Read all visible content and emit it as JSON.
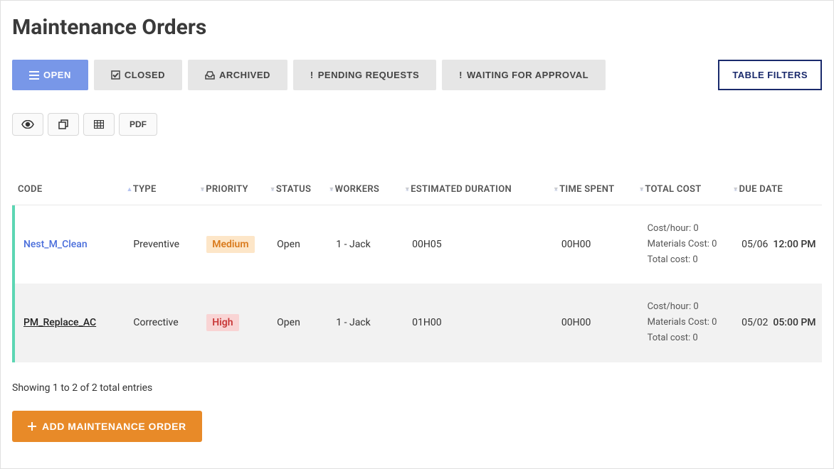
{
  "title": "Maintenance Orders",
  "tabs": {
    "open": "OPEN",
    "closed": "CLOSED",
    "archived": "ARCHIVED",
    "pending": "PENDING REQUESTS",
    "waiting": "WAITING FOR APPROVAL",
    "filters": "TABLE FILTERS"
  },
  "toolbar": {
    "pdf_label": "PDF"
  },
  "columns": {
    "code": "CODE",
    "type": "TYPE",
    "priority": "PRIORITY",
    "status": "STATUS",
    "workers": "WORKERS",
    "estdur": "ESTIMATED DURATION",
    "timespent": "TIME SPENT",
    "totalcost": "TOTAL COST",
    "duedate": "DUE DATE"
  },
  "rows": [
    {
      "code": "Nest_M_Clean",
      "type": "Preventive",
      "priority": "Medium",
      "priority_class": "medium",
      "status": "Open",
      "workers": "1 - Jack",
      "estdur": "00H05",
      "timespent": "00H00",
      "costhour": "Cost/hour: 0",
      "matcost": "Materials Cost: 0",
      "totalcost": "Total cost: 0",
      "due_date": "05/06",
      "due_time": "12:00 PM"
    },
    {
      "code": "PM_Replace_AC",
      "type": "Corrective",
      "priority": "High",
      "priority_class": "high",
      "status": "Open",
      "workers": "1 - Jack",
      "estdur": "01H00",
      "timespent": "00H00",
      "costhour": "Cost/hour: 0",
      "matcost": "Materials Cost: 0",
      "totalcost": "Total cost: 0",
      "due_date": "05/02",
      "due_time": "05:00 PM"
    }
  ],
  "footer": "Showing 1 to 2 of 2 total entries",
  "add_button": "ADD MAINTENANCE ORDER"
}
